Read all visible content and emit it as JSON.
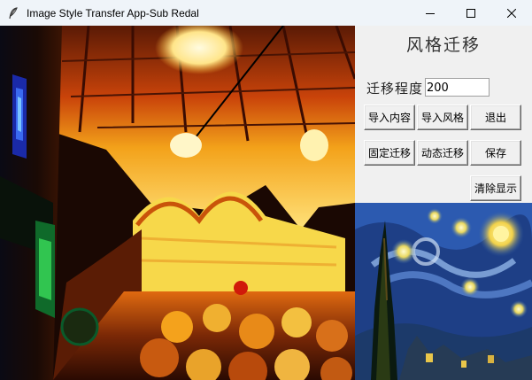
{
  "window": {
    "title": "Image Style Transfer App-Sub Redal",
    "icon": "feather-icon",
    "controls": [
      "minimize-icon",
      "maximize-icon",
      "close-icon"
    ]
  },
  "panel": {
    "title": "风格迁移",
    "degree_label": "迁移程度",
    "degree_value": "200"
  },
  "buttons": {
    "import_content": "导入内容",
    "import_style": "导入风格",
    "exit": "退出",
    "fixed_transfer": "固定迁移",
    "dynamic_transfer": "动态迁移",
    "save": "保存",
    "clear_display": "清除显示"
  },
  "images": {
    "content": "stylized-interior-photo",
    "style": "starry-night-painting"
  }
}
